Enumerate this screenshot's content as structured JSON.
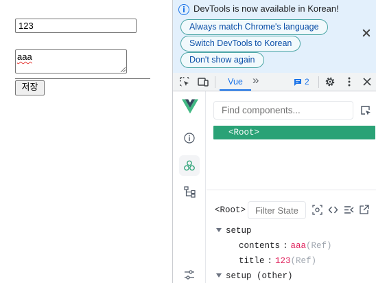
{
  "page": {
    "title_input_value": "123",
    "contents_textarea_value": "aaa",
    "save_button_label": "저장"
  },
  "infobar": {
    "message": "DevTools is now available in Korean!",
    "buttons": [
      "Always match Chrome's language",
      "Switch DevTools to Korean",
      "Don't show again"
    ]
  },
  "toolbar": {
    "active_tab": "Vue",
    "more_tabs": "»",
    "issues_count": "2"
  },
  "vue": {
    "search_placeholder": "Find components...",
    "root_node": "<Root>",
    "inspector_title": "<Root>",
    "filter_placeholder": "Filter State",
    "sections": [
      {
        "name": "setup",
        "props": [
          {
            "key": "contents",
            "value": "aaa",
            "type": "(Ref)"
          },
          {
            "key": "title",
            "value": "123",
            "type": "(Ref)"
          }
        ]
      },
      {
        "name": "setup (other)"
      }
    ]
  },
  "colors": {
    "vue_green": "#41b883",
    "vue_dark": "#34495e",
    "root_bg": "#2aa276",
    "accent_blue": "#1a73e8",
    "infobar_bg": "#e3f0fc",
    "value_red": "#e0245e"
  }
}
